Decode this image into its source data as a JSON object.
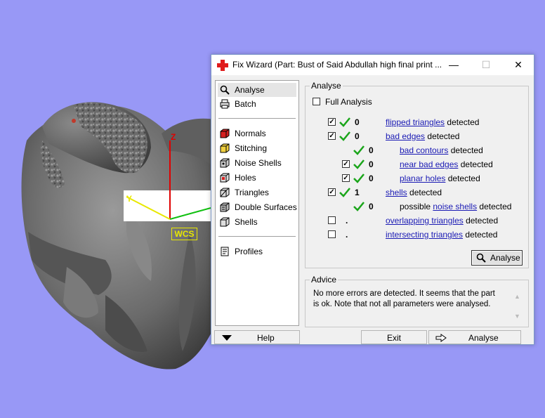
{
  "viewport": {
    "background_color": "#9898f6",
    "wcs_label": "WCS",
    "axis_z_label": "Z",
    "axis_y_label": "Y"
  },
  "window": {
    "title": "Fix Wizard (Part: Bust of Said Abdullah high final print ...",
    "title_icon": "red-cross-icon",
    "minimize_glyph": "—",
    "maximize_glyph": "☐",
    "close_glyph": "✕"
  },
  "nav": {
    "items": [
      {
        "label": "Analyse",
        "icon": "magnifier-icon",
        "selected": true
      },
      {
        "label": "Batch",
        "icon": "printer-icon"
      },
      {
        "label": "Normals",
        "icon": "red-cube-icon"
      },
      {
        "label": "Stitching",
        "icon": "yellow-cube-icon"
      },
      {
        "label": "Noise Shells",
        "icon": "noise-shells-icon"
      },
      {
        "label": "Holes",
        "icon": "holes-icon"
      },
      {
        "label": "Triangles",
        "icon": "triangles-icon"
      },
      {
        "label": "Double Surfaces",
        "icon": "double-surfaces-icon"
      },
      {
        "label": "Shells",
        "icon": "shells-icon"
      },
      {
        "label": "Profiles",
        "icon": "profiles-icon"
      }
    ]
  },
  "analyse": {
    "group_title": "Analyse",
    "full_analysis_label": "Full Analysis",
    "full_analysis_checked": false,
    "rows": [
      {
        "checked": true,
        "has_checkbox": true,
        "ok": true,
        "value": "0",
        "link": "flipped triangles",
        "prefix": "",
        "suffix": " detected"
      },
      {
        "checked": true,
        "has_checkbox": true,
        "ok": true,
        "value": "0",
        "link": "bad edges",
        "prefix": "",
        "suffix": " detected"
      },
      {
        "checked": false,
        "has_checkbox": false,
        "ok": true,
        "value": "0",
        "link": "bad contours",
        "prefix": "",
        "suffix": " detected"
      },
      {
        "checked": true,
        "has_checkbox": true,
        "ok": true,
        "value": "0",
        "link": "near bad edges",
        "prefix": "",
        "suffix": " detected"
      },
      {
        "checked": true,
        "has_checkbox": true,
        "ok": true,
        "value": "0",
        "link": "planar holes",
        "prefix": "",
        "suffix": " detected"
      },
      {
        "checked": true,
        "has_checkbox": true,
        "ok": true,
        "value": "1",
        "link": "shells",
        "prefix": "",
        "suffix": " detected"
      },
      {
        "checked": false,
        "has_checkbox": false,
        "ok": true,
        "value": "0",
        "link": "noise shells",
        "prefix": "possible ",
        "suffix": " detected"
      },
      {
        "checked": false,
        "has_checkbox": true,
        "ok": false,
        "value": ".",
        "link": "overlapping triangles",
        "prefix": "",
        "suffix": " detected"
      },
      {
        "checked": false,
        "has_checkbox": true,
        "ok": false,
        "value": ".",
        "link": "intersecting triangles",
        "prefix": "",
        "suffix": " detected"
      }
    ],
    "analyse_button_label": "Analyse",
    "check_color": "#1aa51a",
    "link_color": "#1a1ab4"
  },
  "advice": {
    "group_title": "Advice",
    "text": "No more errors are detected. It seems that the part is ok. Note that not all parameters were analysed."
  },
  "bottom": {
    "help_label": "Help",
    "exit_label": "Exit",
    "analyse_label": "Analyse"
  }
}
